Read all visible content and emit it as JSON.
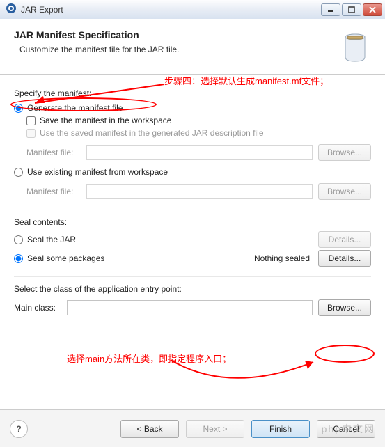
{
  "window": {
    "title": "JAR Export"
  },
  "header": {
    "title": "JAR Manifest Specification",
    "subtitle": "Customize the manifest file for the JAR file."
  },
  "manifest": {
    "group_label": "Specify the manifest:",
    "generate_label": "Generate the manifest file",
    "save_workspace_label": "Save the manifest in the workspace",
    "use_saved_label": "Use the saved manifest in the generated JAR description file",
    "manifest_file_label_1": "Manifest file:",
    "manifest_file_value_1": "",
    "browse_1": "Browse...",
    "use_existing_label": "Use existing manifest from workspace",
    "manifest_file_label_2": "Manifest file:",
    "manifest_file_value_2": "",
    "browse_2": "Browse..."
  },
  "seal": {
    "group_label": "Seal contents:",
    "seal_jar_label": "Seal the JAR",
    "seal_some_label": "Seal some packages",
    "nothing_sealed": "Nothing sealed",
    "details_1": "Details...",
    "details_2": "Details..."
  },
  "entry": {
    "group_label": "Select the class of the application entry point:",
    "main_class_label": "Main class:",
    "main_class_value": "",
    "browse": "Browse..."
  },
  "buttons": {
    "help": "?",
    "back": "< Back",
    "next": "Next >",
    "finish": "Finish",
    "cancel": "Cancel"
  },
  "annotations": {
    "step4": "步骤四：选择默认生成manifest.mf文件；",
    "main_note": "选择main方法所在类，即指定程序入口；"
  },
  "watermark": "php中文网"
}
